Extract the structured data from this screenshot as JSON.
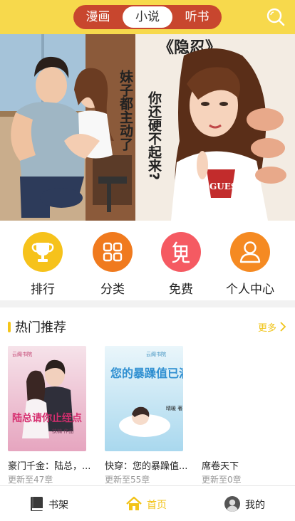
{
  "header": {
    "tabs": [
      {
        "label": "漫画",
        "active": false
      },
      {
        "label": "小说",
        "active": true
      },
      {
        "label": "听书",
        "active": false
      }
    ],
    "search_icon": "search-icon",
    "colors": {
      "bar": "#f7d94c",
      "segment": "#c8462e"
    }
  },
  "banner": {
    "title": "《隐忍》",
    "caption_left": "妹子都主动了",
    "caption_right": "你还硬不起来?",
    "shirt_text": "GUESS"
  },
  "quick_nav": [
    {
      "label": "排行",
      "icon": "trophy-icon",
      "color": "#f6c21b"
    },
    {
      "label": "分类",
      "icon": "grid-icon",
      "color": "#f07a1e"
    },
    {
      "label": "免费",
      "icon": "free-icon",
      "color": "#f55a62"
    },
    {
      "label": "个人中心",
      "icon": "user-icon",
      "color": "#f58a22"
    }
  ],
  "recommend": {
    "title": "热门推荐",
    "more": "更多",
    "books": [
      {
        "title": "豪门千金：陆总，...",
        "update": "更新至47章",
        "cover_text": "陆总请你止绖点",
        "cover_sub": "扶楠 作品",
        "cover_brand": "云阁书院"
      },
      {
        "title": "快穿：您的暴躁值...",
        "update": "更新至55章",
        "cover_text": "您的暴躁值已满",
        "cover_sub": "晴暖 著",
        "cover_brand": "云阁书院"
      },
      {
        "title": "席卷天下",
        "update": "更新至0章",
        "cover_text": "",
        "cover_sub": "",
        "cover_brand": ""
      }
    ]
  },
  "tabbar": [
    {
      "label": "书架",
      "icon": "bookshelf-icon",
      "active": false
    },
    {
      "label": "首页",
      "icon": "home-icon",
      "active": true
    },
    {
      "label": "我的",
      "icon": "avatar-icon",
      "active": false
    }
  ]
}
